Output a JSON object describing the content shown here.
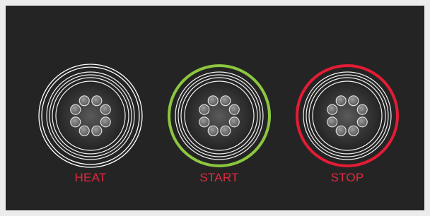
{
  "panel": {
    "buttons": [
      {
        "label": "HEAT",
        "ring_color": "#ffffff",
        "ring_style": "white-rings"
      },
      {
        "label": "START",
        "ring_color": "#8cc63f",
        "ring_style": "accent-ring"
      },
      {
        "label": "STOP",
        "ring_color": "#e31c36",
        "ring_style": "accent-ring"
      }
    ],
    "label_color": "#e02a3f",
    "background_color": "#252424"
  }
}
